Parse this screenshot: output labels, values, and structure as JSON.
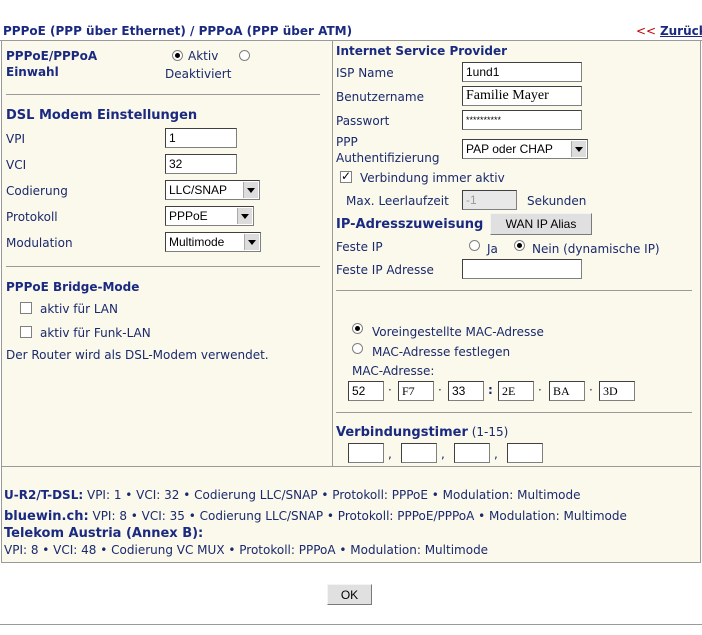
{
  "header": {
    "title": "PPPoE (PPP über Ethernet) / PPPoA (PPP über ATM)",
    "back_prefix": "<<",
    "back_label": "Zurück"
  },
  "left": {
    "einwahl": {
      "label": "PPPoE/PPPoA Einwahl",
      "aktiv_label": "Aktiv",
      "deaktiviert_label": "Deaktiviert",
      "selected": "Aktiv"
    },
    "dsl": {
      "heading": "DSL Modem Einstellungen",
      "vpi_label": "VPI",
      "vpi_value": "1",
      "vci_label": "VCI",
      "vci_value": "32",
      "codierung_label": "Codierung",
      "codierung_value": "LLC/SNAP",
      "protokoll_label": "Protokoll",
      "protokoll_value": "PPPoE",
      "modulation_label": "Modulation",
      "modulation_value": "Multimode"
    },
    "bridge": {
      "heading": "PPPoE Bridge-Mode",
      "lan_label": "aktiv für LAN",
      "funk_label": "aktiv für Funk-LAN",
      "note": "Der Router wird als DSL-Modem verwendet."
    }
  },
  "right": {
    "isp": {
      "heading": "Internet Service Provider",
      "name_label": "ISP Name",
      "name_value": "1und1",
      "user_label": "Benutzername",
      "user_value": "Familie Mayer",
      "pass_label": "Passwort",
      "pass_value": "**********",
      "auth_label_1": "PPP",
      "auth_label_2": "Authentifizierung",
      "auth_value": "PAP oder CHAP",
      "always_label": "Verbindung immer aktiv",
      "idle_label": "Max. Leerlaufzeit",
      "idle_value": "-1",
      "idle_unit": "Sekunden"
    },
    "ip": {
      "heading": "IP-Adresszuweisung",
      "alias_button": "WAN IP Alias",
      "fixed_label": "Feste IP",
      "ja_label": "Ja",
      "nein_label": "Nein (dynamische IP)",
      "address_label": "Feste IP Adresse",
      "address_value": ""
    },
    "mac": {
      "preset_label": "Voreingestellte MAC-Adresse",
      "set_label": "MAC-Adresse festlegen",
      "address_label": "MAC-Adresse:",
      "octets": [
        "52",
        "F7",
        "33",
        "2E",
        "BA",
        "3D"
      ],
      "separators": [
        "·",
        "·",
        ":",
        "·",
        "·"
      ]
    },
    "timer": {
      "heading": "Verbindungstimer",
      "range": "(1-15)",
      "separators": [
        ",",
        ",",
        ","
      ]
    }
  },
  "bottom": {
    "line1_name": "U-R2/T-DSL:",
    "line1_text": "VPI: 1 • VCI: 32 • Codierung LLC/SNAP • Protokoll: PPPoE • Modulation: Multimode",
    "line2_name": "bluewin.ch:",
    "line2_text": "VPI: 8 • VCI: 35 • Codierung LLC/SNAP • Protokoll: PPPoE/PPPoA • Modulation: Multimode",
    "line3_name": "Telekom Austria (Annex B):",
    "line4_text": "VPI: 8 • VCI: 48 • Codierung VC MUX • Protokoll: PPPoA • Modulation: Multimode"
  },
  "ok_label": "OK"
}
